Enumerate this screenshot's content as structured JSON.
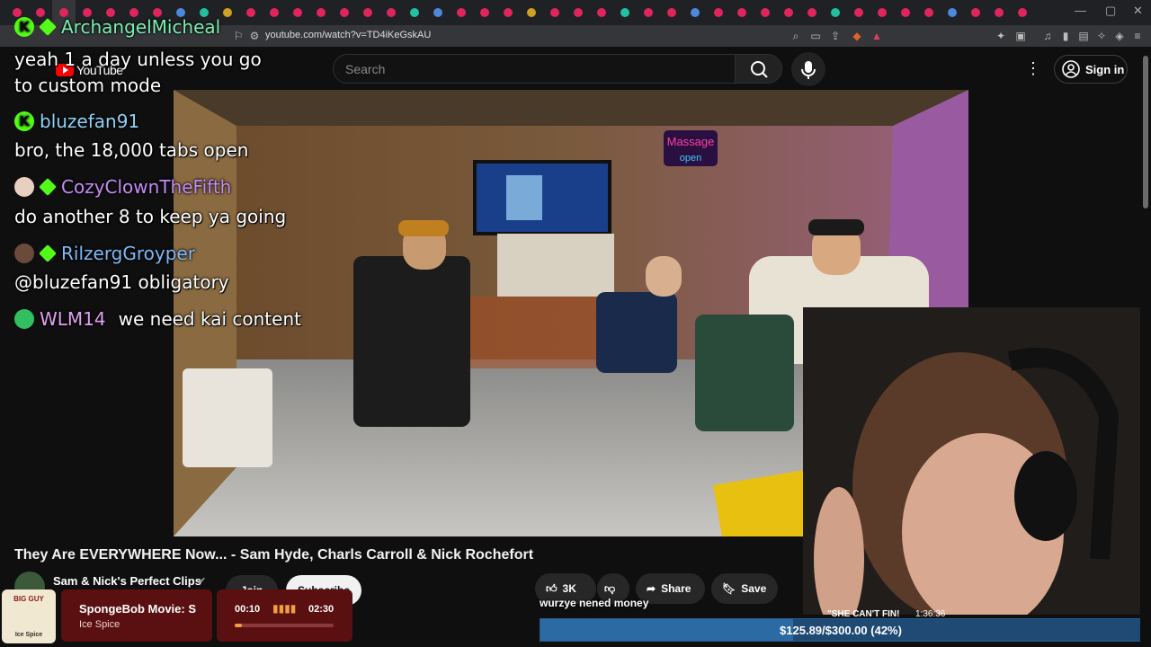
{
  "browser": {
    "url": "youtube.com/watch?v=TD4iKeGskAU",
    "tab_count_visible": 44
  },
  "header": {
    "logo_text": "YouTube",
    "search_placeholder": "Search",
    "signin_label": "Sign in"
  },
  "video": {
    "title": "They Are EVERYWHERE Now... - Sam Hyde, Charls Carroll & Nick Rochefort",
    "channel": "Sam & Nick's Perfect Clips",
    "join_label": "Join",
    "subscribe_label": "Subscribe",
    "like_count": "3K",
    "share_label": "Share",
    "save_label": "Save"
  },
  "chat": {
    "messages": [
      {
        "user": "ArchangelMicheal",
        "text": "yeah 1 a day unless you go to custom mode",
        "color": "#7bf0b2"
      },
      {
        "user": "bluzefan91",
        "text": "bro, the 18,000 tabs open",
        "color": "#8fd2f5"
      },
      {
        "user": "CozyClownTheFifth",
        "text": "do another 8 to keep ya going",
        "color": "#c58cf5"
      },
      {
        "user": "RilzergGroyper",
        "text": "@bluzefan91 obligatory",
        "color": "#7fb8f7"
      },
      {
        "user": "WLM14",
        "text": "we need kai content",
        "color": "#e0a0f0"
      }
    ]
  },
  "music": {
    "brand_line1": "BIG GUY",
    "brand_line2": "Ice Spice",
    "track_title": "SpongeBob Movie: S",
    "artist": "Ice Spice",
    "time_current": "00:10",
    "time_total": "02:30",
    "progress": 0.07
  },
  "stream": {
    "donation_text": "$125.89/$300.00 (42%)",
    "donation_progress": 0.42,
    "song_overlay": "wurzye nened money",
    "cam_caption": "\"SHE CAN'T FIN!",
    "cam_time": "1:36:36"
  },
  "colors": {
    "kick_green": "#53fc18",
    "yt_red": "#ff0000",
    "donation_blue": "#2b6aa3"
  }
}
